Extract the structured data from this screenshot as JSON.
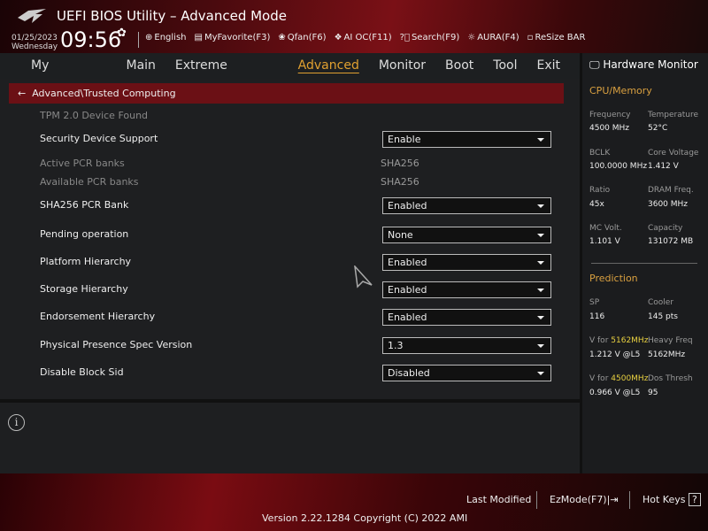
{
  "header": {
    "title": "UEFI BIOS Utility – Advanced Mode",
    "date": "01/25/2023",
    "day": "Wednesday",
    "time": "09:56",
    "tools": [
      {
        "icon": "globe-icon",
        "label": "English"
      },
      {
        "icon": "list-icon",
        "label": "MyFavorite(F3)"
      },
      {
        "icon": "fan-icon",
        "label": "Qfan(F6)"
      },
      {
        "icon": "chip-icon",
        "label": "AI OC(F11)"
      },
      {
        "icon": "question-icon",
        "label": "Search(F9)"
      },
      {
        "icon": "aura-icon",
        "label": "AURA(F4)"
      },
      {
        "icon": "resize-bar-icon",
        "label": "ReSize BAR"
      }
    ]
  },
  "nav": {
    "tabs": [
      "My Favorites",
      "Main",
      "Extreme Tweaker",
      "Advanced",
      "Monitor",
      "Boot",
      "Tool",
      "Exit"
    ],
    "active": "Advanced"
  },
  "breadcrumb": "Advanced\\Trusted Computing",
  "settings": [
    {
      "label": "TPM 2.0 Device Found",
      "type": "info"
    },
    {
      "label": "Security Device Support",
      "type": "dropdown",
      "value": "Enable"
    },
    {
      "label": "Active PCR banks",
      "type": "info",
      "value": "SHA256"
    },
    {
      "label": "Available PCR banks",
      "type": "info",
      "value": "SHA256"
    },
    {
      "label": "SHA256 PCR Bank",
      "type": "dropdown",
      "value": "Enabled"
    },
    {
      "label": "Pending operation",
      "type": "dropdown",
      "value": "None"
    },
    {
      "label": "Platform Hierarchy",
      "type": "dropdown",
      "value": "Enabled"
    },
    {
      "label": "Storage Hierarchy",
      "type": "dropdown",
      "value": "Enabled"
    },
    {
      "label": "Endorsement Hierarchy",
      "type": "dropdown",
      "value": "Enabled"
    },
    {
      "label": "Physical Presence Spec Version",
      "type": "dropdown",
      "value": "1.3"
    },
    {
      "label": "Disable Block Sid",
      "type": "dropdown",
      "value": "Disabled"
    }
  ],
  "hw": {
    "title": "Hardware Monitor",
    "cpu_title": "CPU/Memory",
    "cpu": [
      [
        "Frequency",
        "4500 MHz",
        "Temperature",
        "52°C"
      ],
      [
        "BCLK",
        "100.0000 MHz",
        "Core Voltage",
        "1.412 V"
      ],
      [
        "Ratio",
        "45x",
        "DRAM Freq.",
        "3600 MHz"
      ],
      [
        "MC Volt.",
        "1.101 V",
        "Capacity",
        "131072 MB"
      ]
    ],
    "pred_title": "Prediction",
    "sp_label": "SP",
    "sp": "116",
    "cooler_label": "Cooler",
    "cooler": "145 pts",
    "vfor": "V for ",
    "f1": "5162MHz",
    "v1": "1.212 V @L5",
    "heavy_label": "Heavy Freq",
    "heavy": "5162MHz",
    "f2": "4500MHz",
    "v2": "0.966 V @L5",
    "dos_label": "Dos Thresh",
    "dos": "95"
  },
  "footer": {
    "last_modified": "Last Modified",
    "ezmode": "EzMode(F7)|",
    "hotkeys": "Hot Keys",
    "version": "Version 2.22.1284 Copyright (C) 2022 AMI"
  },
  "colors": {
    "accent": "#e0a030",
    "breadcrumb_bg": "#6b1015",
    "highlight": "#e8d040"
  }
}
